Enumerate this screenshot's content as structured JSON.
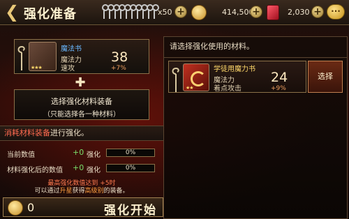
{
  "header": {
    "title": "强化准备",
    "keys_count": "x50",
    "gold": "414,500",
    "gems": "2,030"
  },
  "equip": {
    "name": "魔法书",
    "stat1": "魔法力",
    "stat2": "速攻",
    "value": "38",
    "bonus": "+7%",
    "stars": "★★★"
  },
  "select_button": {
    "line1": "选择强化材料装备",
    "line2": "（只能选择各一种材料）"
  },
  "consume": {
    "highlight": "消耗材料装备",
    "rest": "进行强化。"
  },
  "rows": [
    {
      "label": "当前数值",
      "value": "+0",
      "tag": "强化",
      "bar": "0%",
      "progress": 0
    },
    {
      "label": "材料强化后的数值",
      "value": "+0",
      "tag": "强化",
      "bar": "0%",
      "progress": 0
    }
  ],
  "notes": {
    "line1": "最高强化数值达到 +5时",
    "line2_a": "可以通过",
    "line2_b": "升星",
    "line2_c": "获得",
    "line2_d": "高级别",
    "line2_e": "的装备。"
  },
  "start": {
    "cost": "0",
    "label": "强化开始"
  },
  "right": {
    "header": "请选择强化使用的材料。",
    "material": {
      "name": "学徒用魔力书",
      "stat1": "魔法力",
      "stat2": "着点攻击",
      "value": "24",
      "bonus": "+9%",
      "stars": "★★"
    },
    "choose_label": "选择"
  },
  "colors": {
    "accent": "#e9c878",
    "progress": "#7ade6a",
    "warning": "#ff7a50"
  }
}
